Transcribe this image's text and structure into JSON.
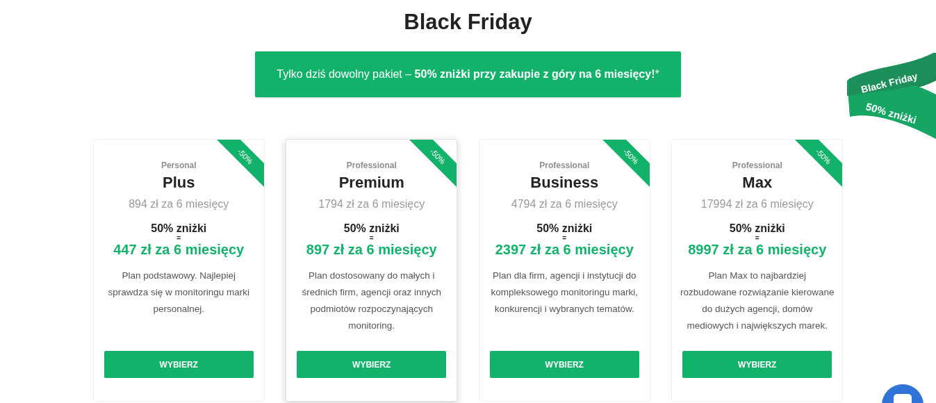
{
  "title": "Black Friday",
  "promo_banner": "Tylko dziś dowolny pakiet – **50% zniżki przy zakupie z góry na 6 miesięcy!***",
  "corner_ribbon": {
    "line_1": "Black Friday",
    "line_2": "50% zniżki"
  },
  "plans": [
    {
      "badge": "-50%",
      "tier": "Personal",
      "name": "Plus",
      "regular_price": "894 zł za 6 miesięcy",
      "discount": "50% zniżki",
      "equals": "=",
      "final_price": "447 zł za 6 miesięcy",
      "description": "Plan podstawowy. Najlepiej sprawdza się w monitoringu marki personalnej.",
      "button": "WYBIERZ",
      "highlighted": false
    },
    {
      "badge": "-50%",
      "tier": "Professional",
      "name": "Premium",
      "regular_price": "1794 zł za 6 miesięcy",
      "discount": "50% zniżki",
      "equals": "=",
      "final_price": "897 zł za 6 miesięcy",
      "description": "Plan dostosowany do małych i średnich firm, agencji oraz innych podmiotów rozpoczynających monitoring.",
      "button": "WYBIERZ",
      "highlighted": true
    },
    {
      "badge": "-50%",
      "tier": "Professional",
      "name": "Business",
      "regular_price": "4794 zł za 6 miesięcy",
      "discount": "50% zniżki",
      "equals": "=",
      "final_price": "2397 zł za 6 miesięcy",
      "description": "Plan dla firm, agencji i instytucji do kompleksowego monitoringu marki, konkurencji i wybranych tematów.",
      "button": "WYBIERZ",
      "highlighted": false
    },
    {
      "badge": "-50%",
      "tier": "Professional",
      "name": "Max",
      "regular_price": "17994 zł za 6 miesięcy",
      "discount": "50% zniżki",
      "equals": "=",
      "final_price": "8997 zł za 6 miesięcy",
      "description": "Plan Max to najbardziej rozbudowane rozwiązanie kierowane do dużych agencji, domów mediowych i największych marek.",
      "button": "WYBIERZ",
      "highlighted": false
    }
  ]
}
